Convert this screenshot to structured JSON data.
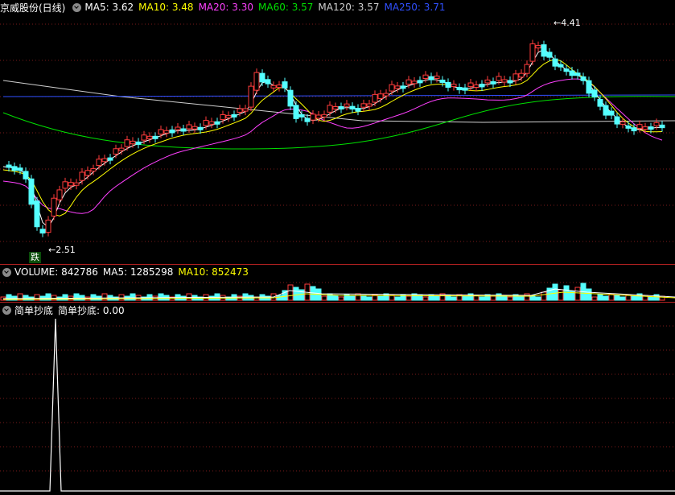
{
  "main": {
    "stock_title": "京威股份(日线)",
    "ma_labels": [
      {
        "text": "MA5: 3.62",
        "color": "#ffffff"
      },
      {
        "text": "MA10: 3.48",
        "color": "#ffff00"
      },
      {
        "text": "MA20: 3.30",
        "color": "#ff40ff"
      },
      {
        "text": "MA60: 3.57",
        "color": "#00e000"
      },
      {
        "text": "MA120: 3.57",
        "color": "#d0d0d0"
      },
      {
        "text": "MA250: 3.71",
        "color": "#3050ff"
      }
    ],
    "high_label": "4.41",
    "low_label": "2.51",
    "signal_tag": "跌"
  },
  "volume": {
    "labels": [
      {
        "text": "VOLUME: 842786",
        "color": "#ffffff"
      },
      {
        "text": "MA5: 1285298",
        "color": "#ffffff"
      },
      {
        "text": "MA10: 852473",
        "color": "#ffff00"
      }
    ]
  },
  "indicator": {
    "labels": [
      {
        "text": "简单抄底",
        "color": "#ffffff"
      },
      {
        "text": "简单抄底: 0.00",
        "color": "#ffffff"
      }
    ]
  },
  "colors": {
    "up": "#ff3c3c",
    "down": "#54ffff",
    "grid": "#7a1a1a",
    "separator": "#b02020"
  }
}
